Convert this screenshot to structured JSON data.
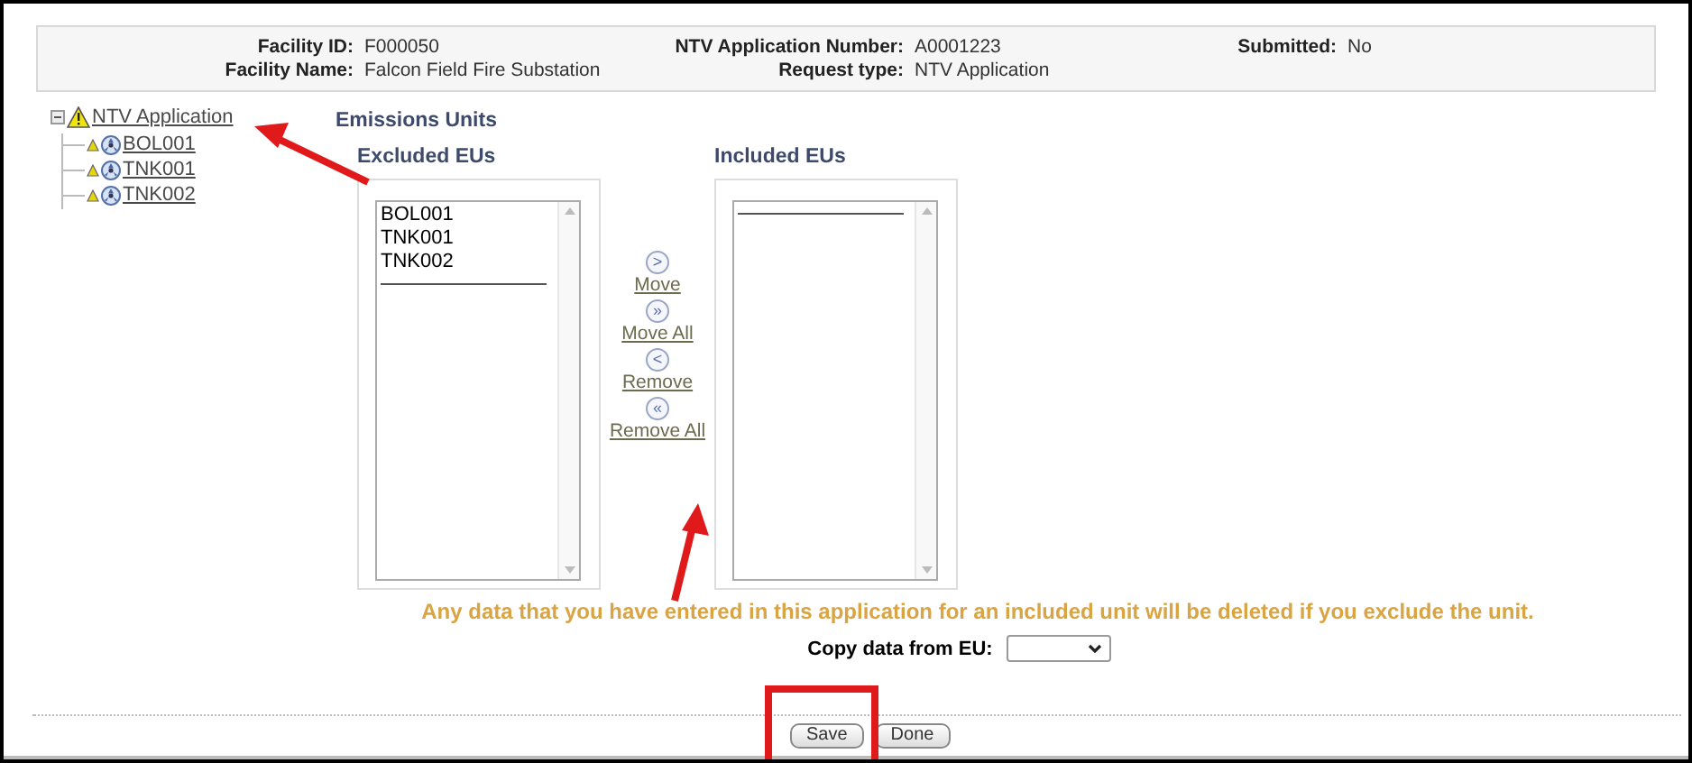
{
  "header": {
    "fields": [
      {
        "label": "Facility ID:",
        "value": "F000050"
      },
      {
        "label": "Facility Name:",
        "value": "Falcon Field Fire Substation"
      },
      {
        "label": "NTV Application Number:",
        "value": "A0001223"
      },
      {
        "label": "Request type:",
        "value": "NTV Application"
      },
      {
        "label": "Submitted:",
        "value": "No"
      }
    ]
  },
  "tree": {
    "label": "NTV Application",
    "expanded": true,
    "children": [
      {
        "label": "BOL001"
      },
      {
        "label": "TNK001"
      },
      {
        "label": "TNK002"
      }
    ]
  },
  "section_title": "Emissions Units",
  "excluded": {
    "label": "Excluded EUs",
    "items": [
      "BOL001",
      "TNK001",
      "TNK002"
    ]
  },
  "included": {
    "label": "Included EUs"
  },
  "move_buttons": [
    {
      "symbol": ">",
      "label": "Move"
    },
    {
      "symbol": "»",
      "label": "Move All"
    },
    {
      "symbol": "<",
      "label": "Remove"
    },
    {
      "symbol": "«",
      "label": "Remove All"
    }
  ],
  "warning": "Any data that you have entered in this application for an included unit will be deleted if you exclude the unit.",
  "copy_from": {
    "label": "Copy data from EU:"
  },
  "buttons": [
    "Save",
    "Done"
  ]
}
